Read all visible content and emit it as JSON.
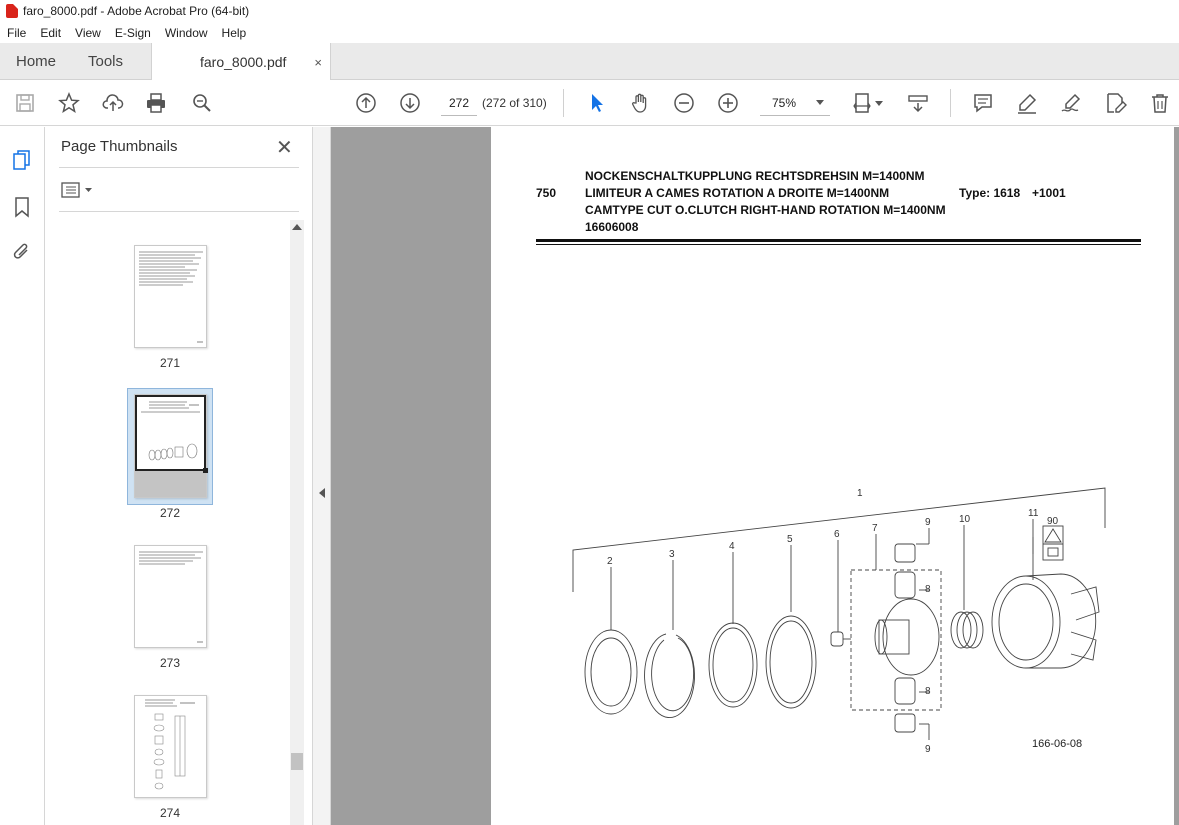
{
  "window": {
    "title": "faro_8000.pdf - Adobe Acrobat Pro (64-bit)"
  },
  "menu": [
    "File",
    "Edit",
    "View",
    "E-Sign",
    "Window",
    "Help"
  ],
  "tabs": {
    "home": "Home",
    "tools": "Tools",
    "document": "faro_8000.pdf",
    "close": "×"
  },
  "toolbar": {
    "page_current": "272",
    "page_count": "(272 of 310)",
    "zoom": "75%"
  },
  "panel": {
    "title": "Page Thumbnails",
    "close": "✕",
    "thumbnails": [
      {
        "label": "271",
        "selected": false
      },
      {
        "label": "272",
        "selected": true
      },
      {
        "label": "273",
        "selected": false
      },
      {
        "label": "274",
        "selected": false
      }
    ]
  },
  "document": {
    "item_no": "750",
    "title_de": "NOCKENSCHALTKUPPLUNG RECHTSDREHSIN M=1400NM",
    "title_fr": "LIMITEUR A CAMES ROTATION A DROITE M=1400NM",
    "title_en": "CAMTYPE CUT O.CLUTCH RIGHT-HAND ROTATION M=1400NM",
    "part_no": "16606008",
    "type_label": "Type: 1618",
    "type_suffix": "+1001",
    "drawing_ref": "166-06-08",
    "callouts": [
      "1",
      "2",
      "3",
      "4",
      "5",
      "6",
      "7",
      "8",
      "8",
      "9",
      "9",
      "10",
      "11",
      "90"
    ]
  },
  "colors": {
    "accent_selected": "#cfe2f3",
    "viewer_bg": "#9e9e9e",
    "pdf_icon": "#d9241b"
  }
}
